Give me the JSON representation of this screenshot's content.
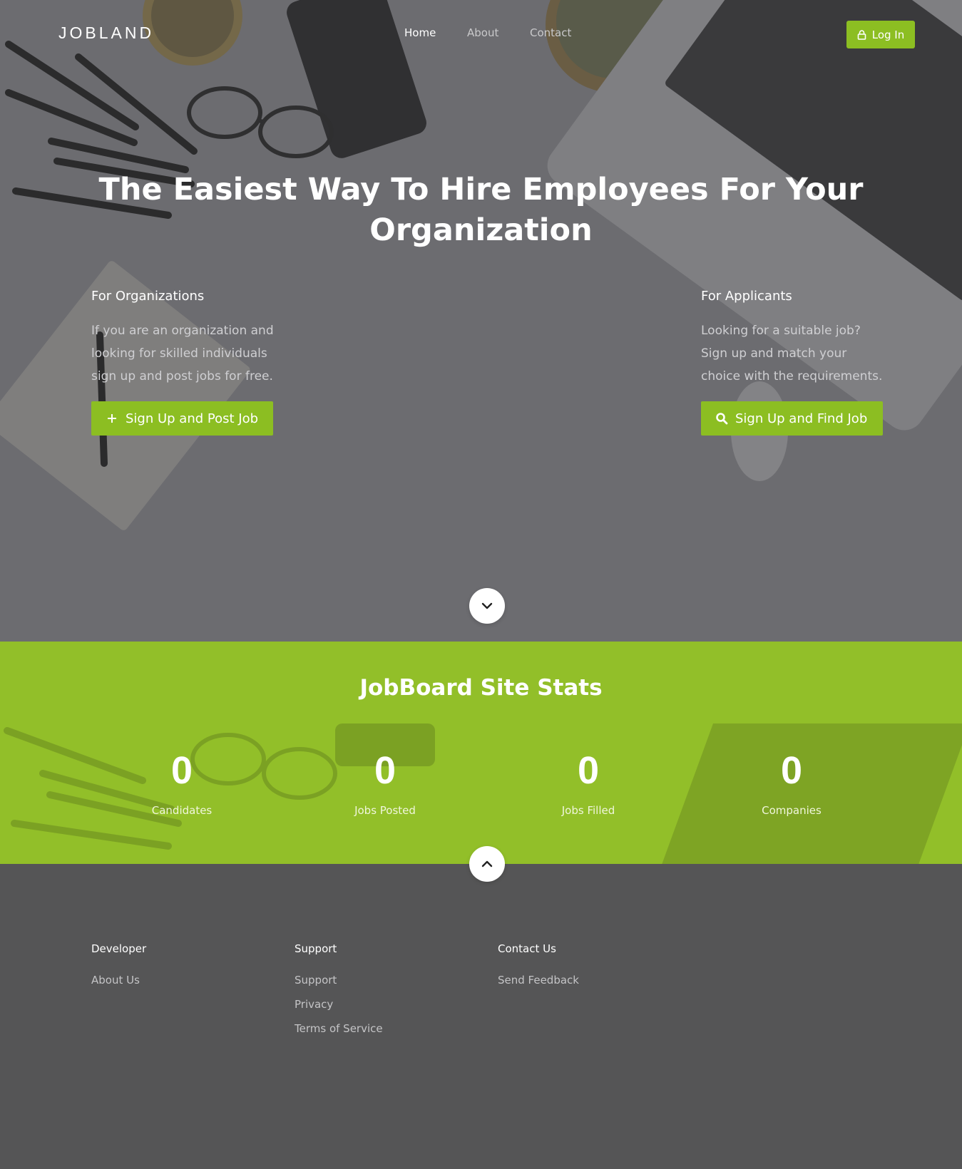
{
  "colors": {
    "accent": "#8cbe22",
    "stats_background": "#92bf29",
    "footer_background": "#555556"
  },
  "header": {
    "logo": "JOBLAND",
    "nav": [
      "Home",
      "About",
      "Contact"
    ],
    "login": {
      "label": "Log In",
      "icon": "lock-icon"
    }
  },
  "hero": {
    "headline": "The Easiest Way To Hire Employees For Your Organization",
    "organizations": {
      "title": "For Organizations",
      "text": "If you are an organization and looking for skilled individuals sign up and post jobs for free.",
      "button": {
        "label": "Sign Up and Post Job",
        "icon": "plus-icon"
      }
    },
    "applicants": {
      "title": "For Applicants",
      "text": "Looking for a suitable job? Sign up and match your choice with the requirements.",
      "button": {
        "label": "Sign Up and Find Job",
        "icon": "search-icon"
      }
    },
    "scroll_down_icon": "chevron-down-icon"
  },
  "stats": {
    "title": "JobBoard Site Stats",
    "items": [
      {
        "value": "0",
        "label": "Candidates"
      },
      {
        "value": "0",
        "label": "Jobs Posted"
      },
      {
        "value": "0",
        "label": "Jobs Filled"
      },
      {
        "value": "0",
        "label": "Companies"
      }
    ],
    "scroll_up_icon": "chevron-up-icon"
  },
  "footer": {
    "columns": [
      {
        "title": "Developer",
        "links": [
          "About Us"
        ]
      },
      {
        "title": "Support",
        "links": [
          "Support",
          "Privacy",
          "Terms of Service"
        ]
      },
      {
        "title": "Contact Us",
        "links": [
          "Send Feedback"
        ]
      }
    ]
  }
}
